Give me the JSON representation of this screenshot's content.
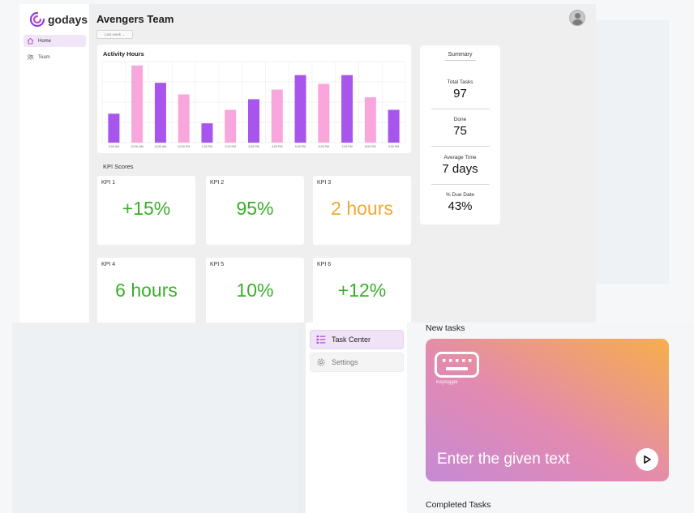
{
  "dashboard": {
    "logo_text": "godays",
    "title": "Avengers Team",
    "range_label": "Last week ⌄",
    "nav": [
      {
        "label": "Home",
        "icon": "home-icon",
        "active": true
      },
      {
        "label": "Team",
        "icon": "team-icon",
        "active": false
      }
    ],
    "chart_data": {
      "type": "bar",
      "title": "Activity Hours",
      "categories": [
        "9:00 AM",
        "10:00 AM",
        "11:00 AM",
        "12:00 PM",
        "1:00 PM",
        "2:00 PM",
        "3:00 PM",
        "4:00 PM",
        "5:00 PM",
        "6:00 PM",
        "7:00 PM",
        "8:00 PM",
        "9:00 PM"
      ],
      "values": [
        3,
        8,
        6.2,
        5,
        2,
        3.4,
        4.5,
        5.5,
        7,
        6.1,
        7,
        4.7,
        3.4
      ],
      "colors": [
        "#a855ee",
        "#f8a6dc",
        "#a855ee",
        "#f8a6dc",
        "#a855ee",
        "#f8a6dc",
        "#a855ee",
        "#f8a6dc",
        "#a855ee",
        "#f8a6dc",
        "#a855ee",
        "#f8a6dc",
        "#a855ee"
      ],
      "ylim": [
        0,
        8.4
      ],
      "grid": true,
      "xlabel": "",
      "ylabel": ""
    },
    "kpi_heading": "KPI Scores",
    "kpis": [
      {
        "label": "KPI 1",
        "value": "+15%"
      },
      {
        "label": "KPI 2",
        "value": "95%"
      },
      {
        "label": "KPI 3",
        "value": "2 hours"
      },
      {
        "label": "KPI 4",
        "value": "6 hours"
      },
      {
        "label": "KPI 5",
        "value": "10%"
      },
      {
        "label": "KPI 6",
        "value": "+12%"
      }
    ],
    "summary": {
      "title": "Summary",
      "items": [
        {
          "label": "Total Tasks",
          "value": "97"
        },
        {
          "label": "Done",
          "value": "75"
        },
        {
          "label": "Average Time",
          "value": "7 days"
        },
        {
          "label": "% Due Date",
          "value": "43%"
        }
      ]
    },
    "colors": {
      "accent_purple": "#a855ee",
      "accent_pink": "#f8a6dc",
      "kpi_green": "#3aae2a",
      "kpi_orange": "#f0a832"
    }
  },
  "mobile": {
    "nav": [
      {
        "label": "Task Center",
        "icon": "task-list-icon",
        "active": true
      },
      {
        "label": "Settings",
        "icon": "gear-icon",
        "active": false
      }
    ],
    "new_tasks_heading": "New tasks",
    "task": {
      "icon": "keyboard-icon",
      "name": "Keylogger",
      "text": "Enter the given text",
      "action_icon": "play-icon"
    },
    "completed_heading": "Completed Tasks"
  }
}
